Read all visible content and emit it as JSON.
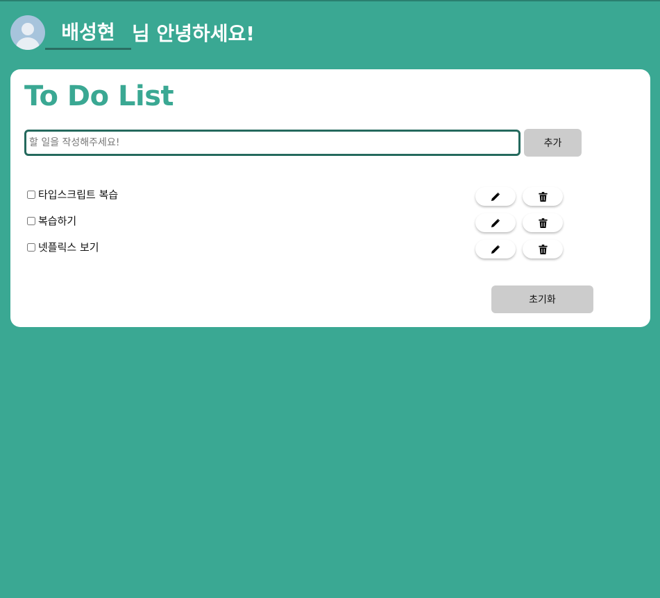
{
  "header": {
    "username": "배성현",
    "greeting": "님 안녕하세요!"
  },
  "card": {
    "title": "To Do List",
    "input": {
      "value": "",
      "placeholder": "할 일을 작성해주세요!"
    },
    "add_label": "추가",
    "todos": [
      {
        "text": "타입스크립트 복습",
        "checked": false
      },
      {
        "text": "복습하기",
        "checked": false
      },
      {
        "text": "넷플릭스 보기",
        "checked": false
      }
    ],
    "reset_label": "초기화"
  },
  "icons": {
    "edit": "pencil-icon",
    "delete": "trash-icon",
    "avatar": "user-avatar-icon"
  },
  "colors": {
    "background": "#3aa893",
    "accent": "#3aa893",
    "input_border": "#24695d",
    "button_gray": "#cccccc"
  }
}
